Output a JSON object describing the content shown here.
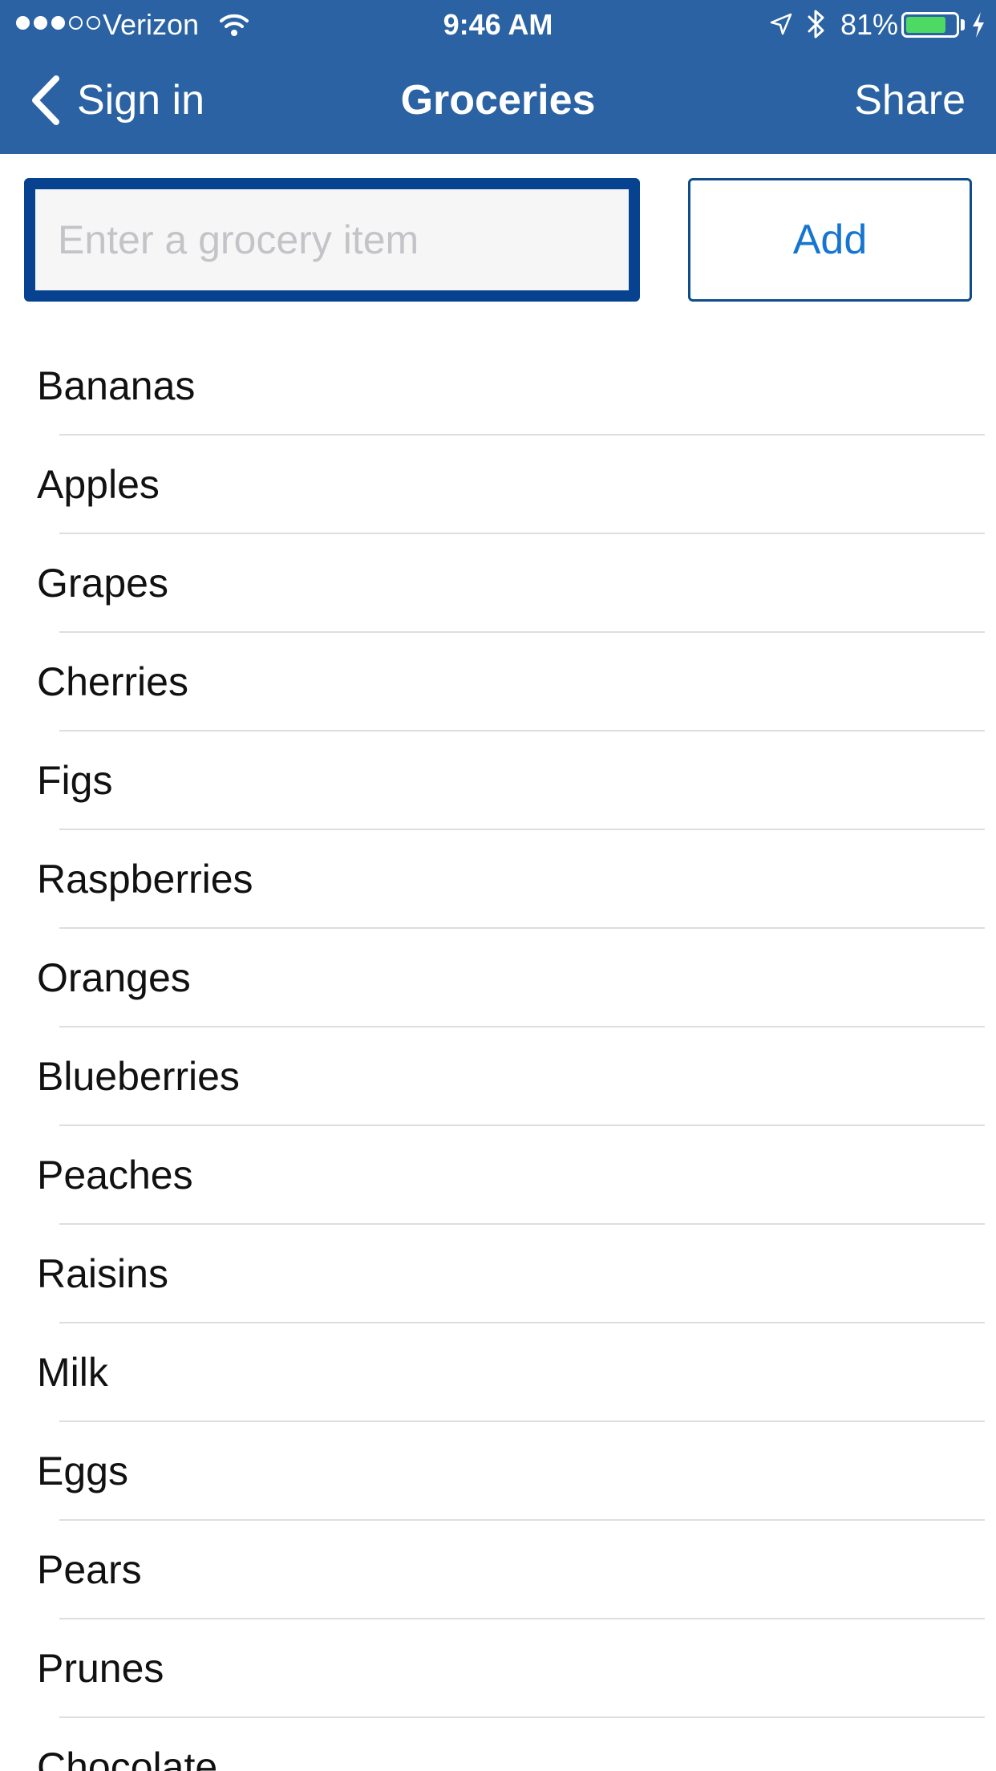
{
  "status_bar": {
    "carrier": "Verizon",
    "time": "9:46 AM",
    "battery_percent": "81%",
    "battery_level": 0.81,
    "signal_bars_filled": 3,
    "signal_bars_total": 5
  },
  "nav": {
    "back_label": "Sign in",
    "title": "Groceries",
    "share_label": "Share"
  },
  "entry": {
    "placeholder": "Enter a grocery item",
    "add_label": "Add"
  },
  "groceries": [
    "Bananas",
    "Apples",
    "Grapes",
    "Cherries",
    "Figs",
    "Raspberries",
    "Oranges",
    "Blueberries",
    "Peaches",
    "Raisins",
    "Milk",
    "Eggs",
    "Pears",
    "Prunes",
    "Chocolate"
  ],
  "colors": {
    "header": "#2a62a3",
    "input_border": "#074290",
    "add_text": "#1575d1",
    "battery_fill": "#4cd964"
  }
}
